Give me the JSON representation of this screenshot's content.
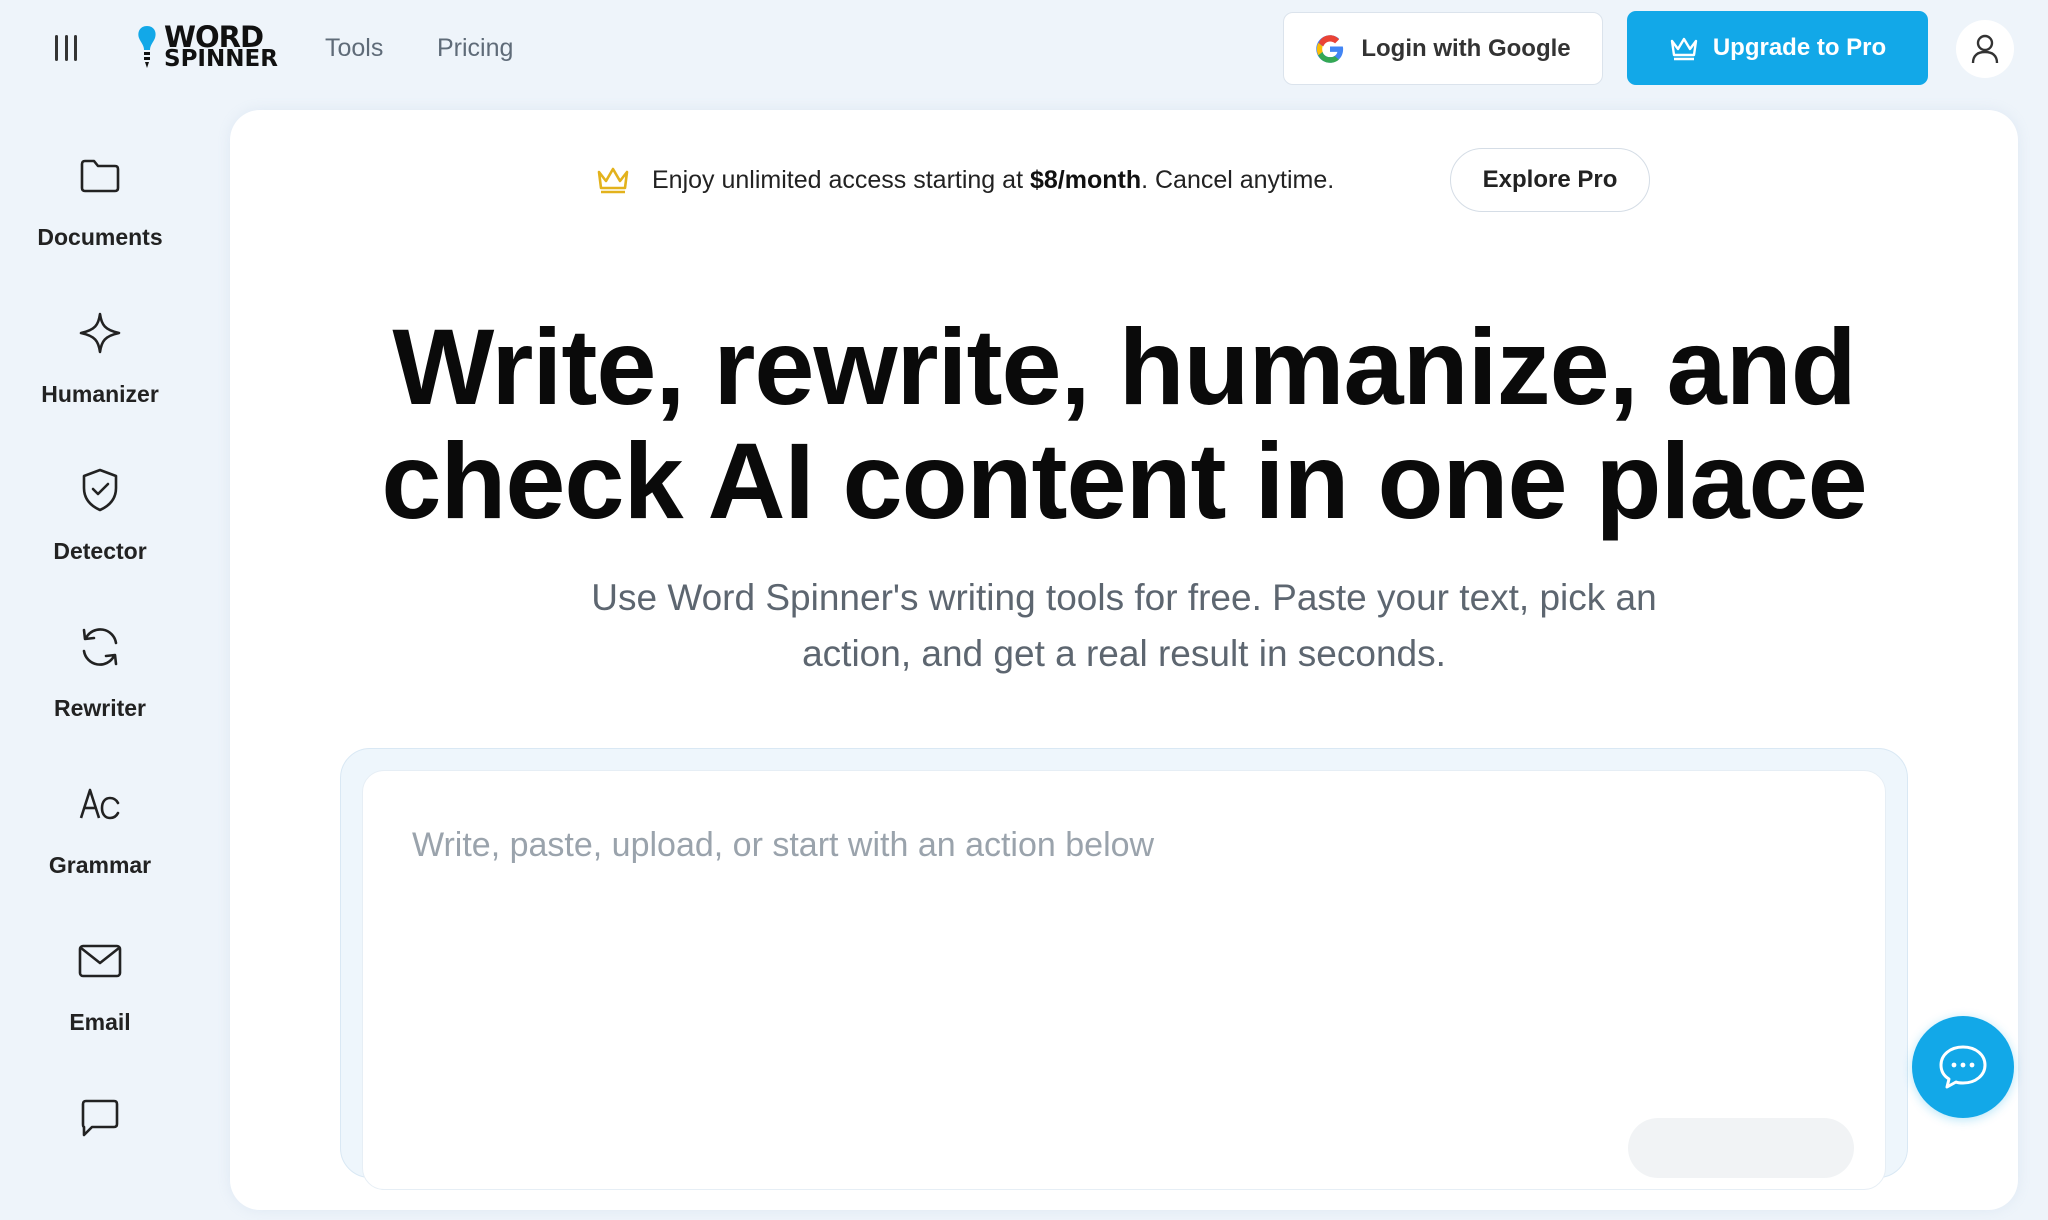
{
  "header": {
    "logo_line1": "WORD",
    "logo_line2": "SPINNER",
    "nav": [
      {
        "label": "Tools"
      },
      {
        "label": "Pricing"
      }
    ],
    "login_label": "Login with Google",
    "upgrade_label": "Upgrade to Pro",
    "icons": {
      "menu": "menu-bars-icon",
      "google": "google-logo-icon",
      "crown": "crown-icon",
      "user": "user-icon"
    }
  },
  "sidebar": {
    "items": [
      {
        "label": "Documents",
        "icon": "folder-icon"
      },
      {
        "label": "Humanizer",
        "icon": "sparkle-icon"
      },
      {
        "label": "Detector",
        "icon": "shield-check-icon"
      },
      {
        "label": "Rewriter",
        "icon": "refresh-icon"
      },
      {
        "label": "Grammar",
        "icon": "grammar-icon"
      },
      {
        "label": "Email",
        "icon": "mail-icon"
      },
      {
        "label": "",
        "icon": "chat-icon"
      }
    ]
  },
  "promo": {
    "text_before": "Enjoy unlimited access starting at ",
    "price": "$8/month",
    "text_after": ". Cancel anytime.",
    "button_label": "Explore Pro"
  },
  "hero": {
    "title_line1": "Write, rewrite, humanize, and",
    "title_line2": "check AI content in one place",
    "subtitle_line1": "Use Word Spinner's writing tools for free. Paste your text, pick an",
    "subtitle_line2": "action, and get a real result in seconds."
  },
  "editor": {
    "placeholder": "Write, paste, upload, or start with an action below"
  },
  "colors": {
    "accent": "#12a8e8",
    "background": "#eef4fa",
    "crown_gold": "#e3b21c"
  }
}
